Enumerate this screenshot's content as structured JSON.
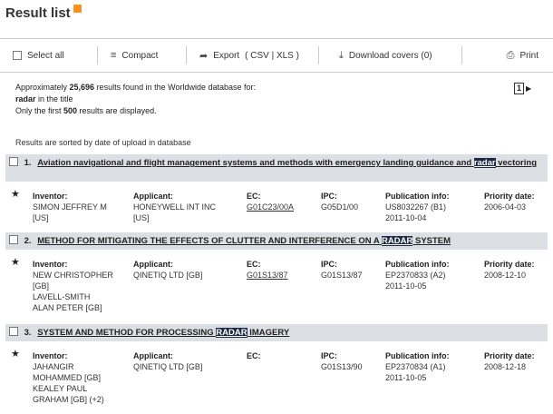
{
  "page": {
    "title": "Result list"
  },
  "toolbar": {
    "select_all": "Select all",
    "compact": "Compact",
    "export": "Export",
    "export_formats": "( CSV | XLS )",
    "download_covers": "Download covers (0)",
    "print": "Print"
  },
  "summary": {
    "line1_prefix": "Approximately ",
    "count": "25,696",
    "line1_suffix": " results found in the Worldwide database for:",
    "query": "radar",
    "query_suffix": " in the title",
    "line3_prefix": "Only the first ",
    "limit": "500",
    "line3_suffix": " results are displayed."
  },
  "pagination": {
    "current": "1"
  },
  "sort_note": "Results are sorted by date of upload in database",
  "labels": {
    "inventor": "Inventor:",
    "applicant": "Applicant:",
    "ec": "EC:",
    "ipc": "IPC:",
    "pub": "Publication info:",
    "priority": "Priority date:"
  },
  "results": [
    {
      "num": "1.",
      "title_before": "Aviation navigational and flight management systems and methods with emergency landing guidance and ",
      "title_hl": "radar",
      "title_after": " vectoring",
      "inventor": [
        "SIMON JEFFREY M",
        "[US]"
      ],
      "applicant": [
        "HONEYWELL INT INC",
        "[US]"
      ],
      "ec": "G01C23/00A",
      "ipc": "G05D1/00",
      "pub": [
        "US8032267 (B1)",
        "2011-10-04"
      ],
      "priority": "2006-04-03"
    },
    {
      "num": "2.",
      "title_before": "METHOD FOR MITIGATING THE EFFECTS OF CLUTTER AND INTERFERENCE ON A ",
      "title_hl": "RADAR",
      "title_after": " SYSTEM",
      "inventor": [
        "NEW CHRISTOPHER",
        "[GB]",
        "LAVELL-SMITH",
        "ALAN PETER [GB]"
      ],
      "applicant": [
        "QINETIQ LTD [GB]"
      ],
      "ec": "G01S13/87",
      "ipc": "G01S13/87",
      "pub": [
        "EP2370833 (A2)",
        "2011-10-05"
      ],
      "priority": "2008-12-10"
    },
    {
      "num": "3.",
      "title_before": "SYSTEM AND METHOD FOR PROCESSING ",
      "title_hl": "RADAR",
      "title_after": " IMAGERY",
      "inventor": [
        "JAHANGIR",
        "MOHAMMED [GB]",
        "KEALEY PAUL",
        "GRAHAM [GB] (+2)"
      ],
      "applicant": [
        "QINETIQ LTD [GB]"
      ],
      "ec": "",
      "ipc": "G01S13/90",
      "pub": [
        "EP2370834 (A1)",
        "2011-10-05"
      ],
      "priority": "2008-12-18"
    }
  ]
}
